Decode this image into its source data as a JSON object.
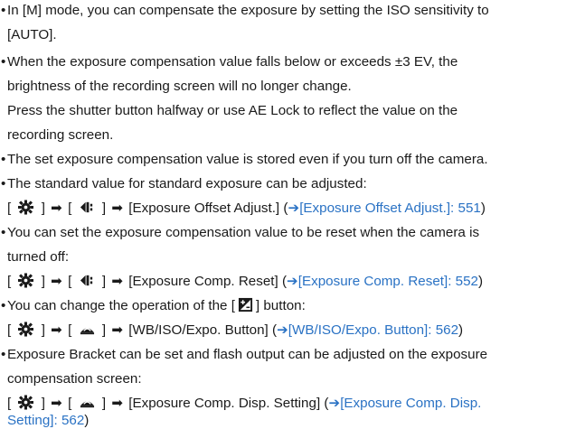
{
  "bullet_char": "•",
  "arrow_char": "➡",
  "link_arrow_char": "➔",
  "colors": {
    "text": "#1a1a1a",
    "link": "#2a72c4",
    "icon": "#1a1a1a"
  },
  "icons": {
    "custom_menu": "gear-icon",
    "image_quality": "camera-quality-icon",
    "operation": "hand-operation-icon",
    "exposure_comp": "exposure-compensation-icon"
  },
  "items": [
    {
      "lines": [
        "In [M] mode, you can compensate the exposure by setting the ISO sensitivity to",
        "[AUTO]."
      ]
    },
    {
      "lines": [
        "When the exposure compensation value falls below or exceeds ±3 EV, the",
        "brightness of the recording screen will no longer change.",
        "Press the shutter button halfway or use AE Lock to reflect the value on the",
        "recording screen."
      ]
    },
    {
      "lines": [
        "The set exposure compensation value is stored even if you turn off the camera."
      ]
    },
    {
      "lines": [
        "The standard value for standard exposure can be adjusted:"
      ],
      "path": {
        "bracket_open": "[",
        "bracket_close": "]",
        "menu": "[Exposure Offset Adjust.]",
        "ref_open": "(",
        "link": "[Exposure Offset Adjust.]: 551",
        "ref_close": ")"
      }
    },
    {
      "lines": [
        "You can set the exposure compensation value to be reset when the camera is",
        "turned off:"
      ],
      "path": {
        "bracket_open": "[",
        "bracket_close": "]",
        "menu": "[Exposure Comp. Reset]",
        "ref_open": "(",
        "link": "[Exposure Comp. Reset]: 552",
        "ref_close": ")"
      }
    },
    {
      "lines": [
        "You can change the operation of the [",
        "] button:"
      ],
      "path": {
        "bracket_open": "[",
        "bracket_close": "]",
        "menu": "[WB/ISO/Expo. Button]",
        "ref_open": "(",
        "link": "[WB/ISO/Expo. Button]: 562",
        "ref_close": ")"
      }
    },
    {
      "lines": [
        "Exposure Bracket can be set and flash output can be adjusted on the exposure",
        "compensation screen:"
      ],
      "path": {
        "bracket_open": "[",
        "bracket_close": "]",
        "menu": "[Exposure Comp. Disp. Setting]",
        "ref_open": "(",
        "link_line1": "[Exposure Comp. Disp.",
        "link_line2": "Setting]: 562",
        "ref_close": ")"
      }
    }
  ]
}
